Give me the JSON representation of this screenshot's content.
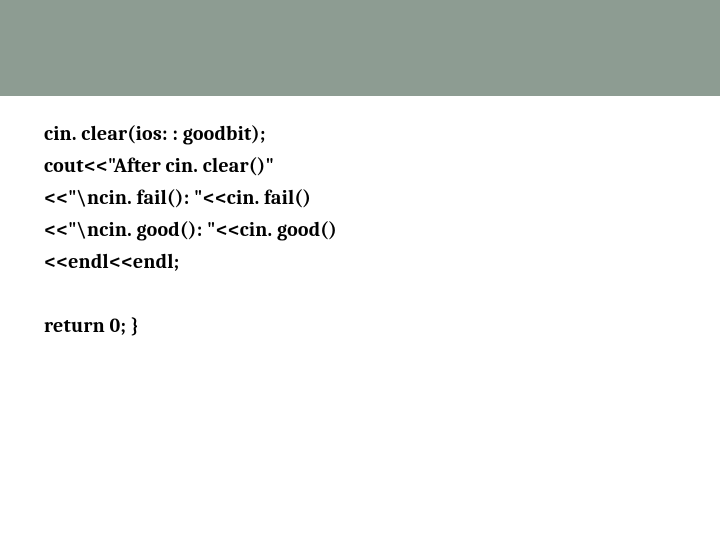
{
  "slide": {
    "lines": [
      "cin. clear(ios: : goodbit);",
      "cout<<\"After cin. clear()\"",
      "<<\"\\ncin. fail(): \"<<cin. fail()",
      "<<\"\\ncin. good(): \"<<cin. good()",
      "<<endl<<endl;",
      "",
      "return 0; }"
    ]
  }
}
